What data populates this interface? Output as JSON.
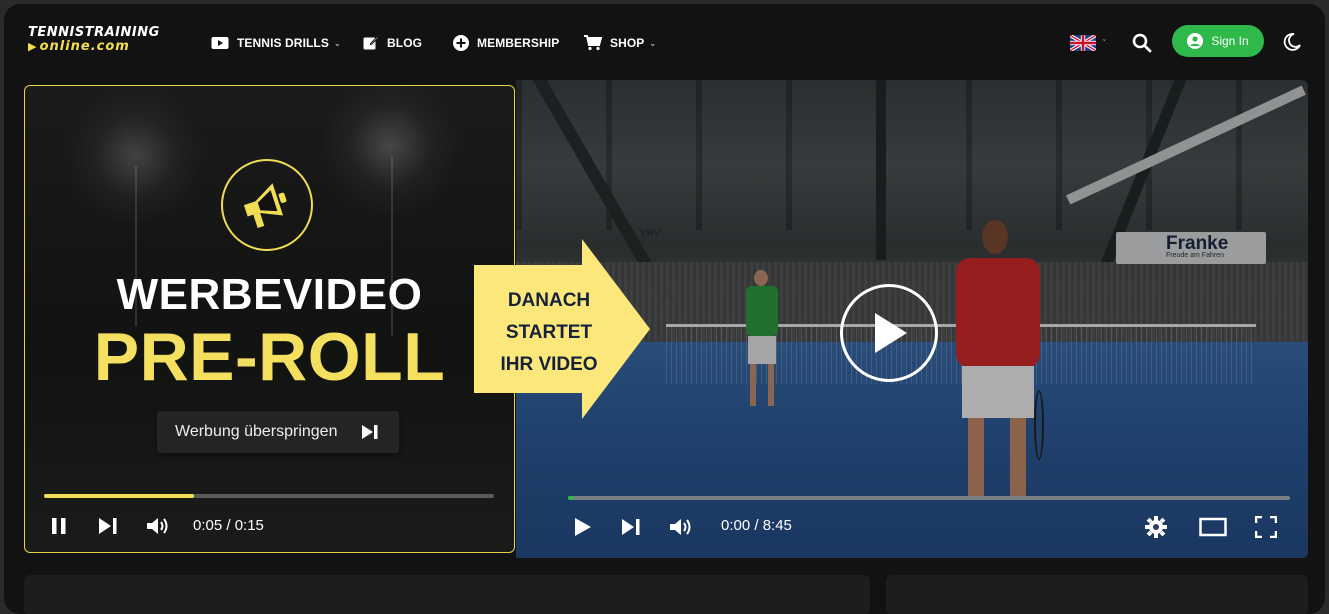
{
  "brand": {
    "line1": "TENNISTRAINING",
    "line2": "online.com"
  },
  "nav": {
    "items": [
      {
        "label": "TENNIS DRILLS",
        "icon": "video-icon",
        "has_dropdown": true
      },
      {
        "label": "BLOG",
        "icon": "edit-icon",
        "has_dropdown": false
      },
      {
        "label": "MEMBERSHIP",
        "icon": "plus-circle-icon",
        "has_dropdown": false
      },
      {
        "label": "SHOP",
        "icon": "cart-icon",
        "has_dropdown": true
      }
    ],
    "language": "en-gb-flag-icon",
    "signin_label": "Sign In",
    "accent": "#2fb94a"
  },
  "ad": {
    "title1": "WERBEVIDEO",
    "title2": "PRE-ROLL",
    "skip_label": "Werbung überspringen",
    "time": "0:05 / 0:15",
    "progress": 0.333,
    "accent": "#f0dc55"
  },
  "arrow": {
    "line1": "DANACH",
    "line2": "STARTET",
    "line3": "IHR VIDEO"
  },
  "video": {
    "time": "0:00 / 8:45",
    "progress": 0.0,
    "banner_text": "Franke",
    "banner_sub": "Freude am Fahren",
    "wall_text": "VHV"
  }
}
